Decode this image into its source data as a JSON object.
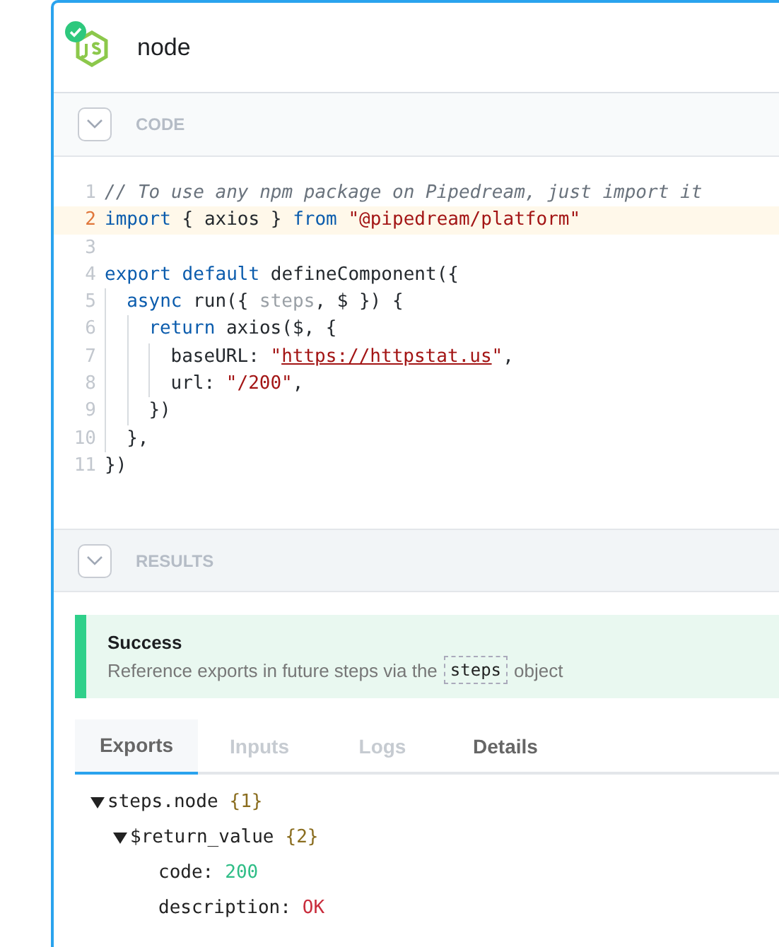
{
  "step": {
    "title": "node",
    "status_ok": true
  },
  "code_section": {
    "label": "CODE",
    "expanded": true
  },
  "code": {
    "lines": [
      {
        "number": "1",
        "selected": false,
        "tokens": [
          {
            "kind": "comment",
            "text": "// To use any npm package on Pipedream, just import it"
          }
        ]
      },
      {
        "number": "2",
        "selected": true,
        "tokens": [
          {
            "kind": "keyword",
            "text": "import"
          },
          {
            "kind": "plain",
            "text": " { axios } "
          },
          {
            "kind": "keyword",
            "text": "from"
          },
          {
            "kind": "string",
            "text": " \"@pipedream/platform\""
          }
        ]
      },
      {
        "number": "3",
        "selected": false
      },
      {
        "number": "4",
        "selected": false,
        "tokens": [
          {
            "kind": "keyword",
            "text": "export"
          },
          {
            "kind": "keyword",
            "text": " default"
          },
          {
            "kind": "plain",
            "text": " defineComponent({"
          }
        ]
      },
      {
        "number": "5",
        "selected": false,
        "tokens": [
          {
            "kind": "keyword",
            "text": "  async"
          },
          {
            "kind": "plain",
            "text": " run({ "
          },
          {
            "kind": "unused",
            "text": "steps"
          },
          {
            "kind": "plain",
            "text": ", $ }) {"
          }
        ]
      },
      {
        "number": "6",
        "selected": false,
        "tokens": [
          {
            "kind": "keyword",
            "text": "    return"
          },
          {
            "kind": "plain",
            "text": " axios($, {"
          }
        ]
      },
      {
        "number": "7",
        "selected": false,
        "tokens": [
          {
            "kind": "plain",
            "text": "      baseURL: "
          },
          {
            "kind": "string",
            "text": "\""
          },
          {
            "kind": "link",
            "text": "https://httpstat.us"
          },
          {
            "kind": "string",
            "text": "\""
          },
          {
            "kind": "plain",
            "text": ","
          }
        ]
      },
      {
        "number": "8",
        "selected": false,
        "tokens": [
          {
            "kind": "plain",
            "text": "      url: "
          },
          {
            "kind": "string",
            "text": "\"/200\""
          },
          {
            "kind": "plain",
            "text": ","
          }
        ]
      },
      {
        "number": "9",
        "selected": false,
        "tokens": [
          {
            "kind": "plain",
            "text": "    })"
          }
        ]
      },
      {
        "number": "10",
        "selected": false,
        "tokens": [
          {
            "kind": "plain",
            "text": "  },"
          }
        ]
      },
      {
        "number": "11",
        "selected": false,
        "tokens": [
          {
            "kind": "plain",
            "text": "})"
          }
        ]
      }
    ]
  },
  "results_section": {
    "label": "RESULTS",
    "expanded": true
  },
  "alert": {
    "title": "Success",
    "message_before": "Reference exports in future steps via the",
    "code": "steps",
    "message_after": "object"
  },
  "tabs": [
    {
      "label": "Exports",
      "selected": true,
      "disabled": false
    },
    {
      "label": "Inputs",
      "selected": false,
      "disabled": true
    },
    {
      "label": "Logs",
      "selected": false,
      "disabled": true
    },
    {
      "label": "Details",
      "selected": false,
      "disabled": false
    }
  ],
  "tree": [
    {
      "key": "steps.node",
      "count": "{1}",
      "expanded": true,
      "children": [
        {
          "key": "$return_value",
          "count": "{2}",
          "expanded": true,
          "children": [
            {
              "key": "code:",
              "value": "200",
              "kind": "number"
            },
            {
              "key": "description:",
              "value": "OK",
              "kind": "string"
            }
          ]
        }
      ]
    }
  ]
}
